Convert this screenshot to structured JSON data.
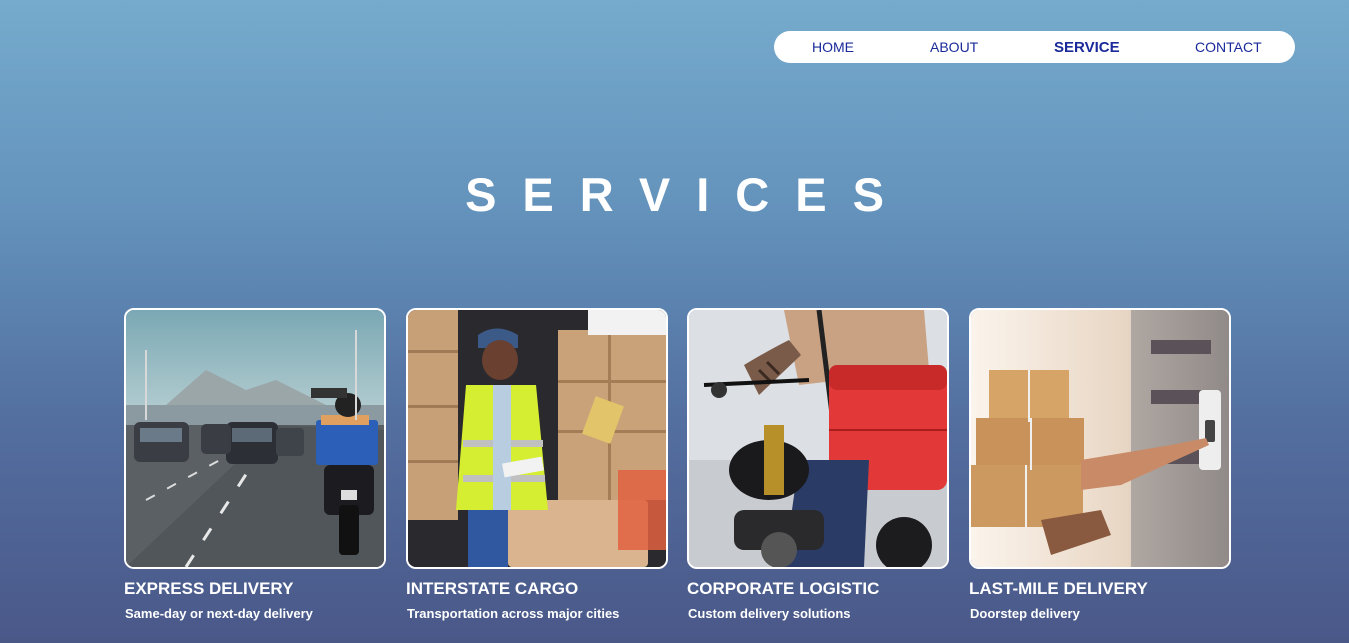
{
  "nav": {
    "items": [
      {
        "label": "HOME"
      },
      {
        "label": "ABOUT"
      },
      {
        "label": "SERVICE",
        "active": true
      },
      {
        "label": "CONTACT"
      }
    ],
    "active_color": "#1a2a9a"
  },
  "page": {
    "title": "SERVICES"
  },
  "services": [
    {
      "title": "EXPRESS DELIVERY",
      "subtitle": "Same-day or next-day delivery",
      "image": "motorcycle-courier-highway-photo"
    },
    {
      "title": "INTERSTATE CARGO",
      "subtitle": "Transportation across major cities",
      "image": "cargo-worker-boxes-photo"
    },
    {
      "title": "CORPORATE LOGISTIC",
      "subtitle": "Custom delivery solutions",
      "image": "delivery-rider-red-bag-photo"
    },
    {
      "title": "LAST-MILE DELIVERY",
      "subtitle": "Doorstep delivery",
      "image": "doorstep-parcels-doorbell-photo"
    }
  ]
}
